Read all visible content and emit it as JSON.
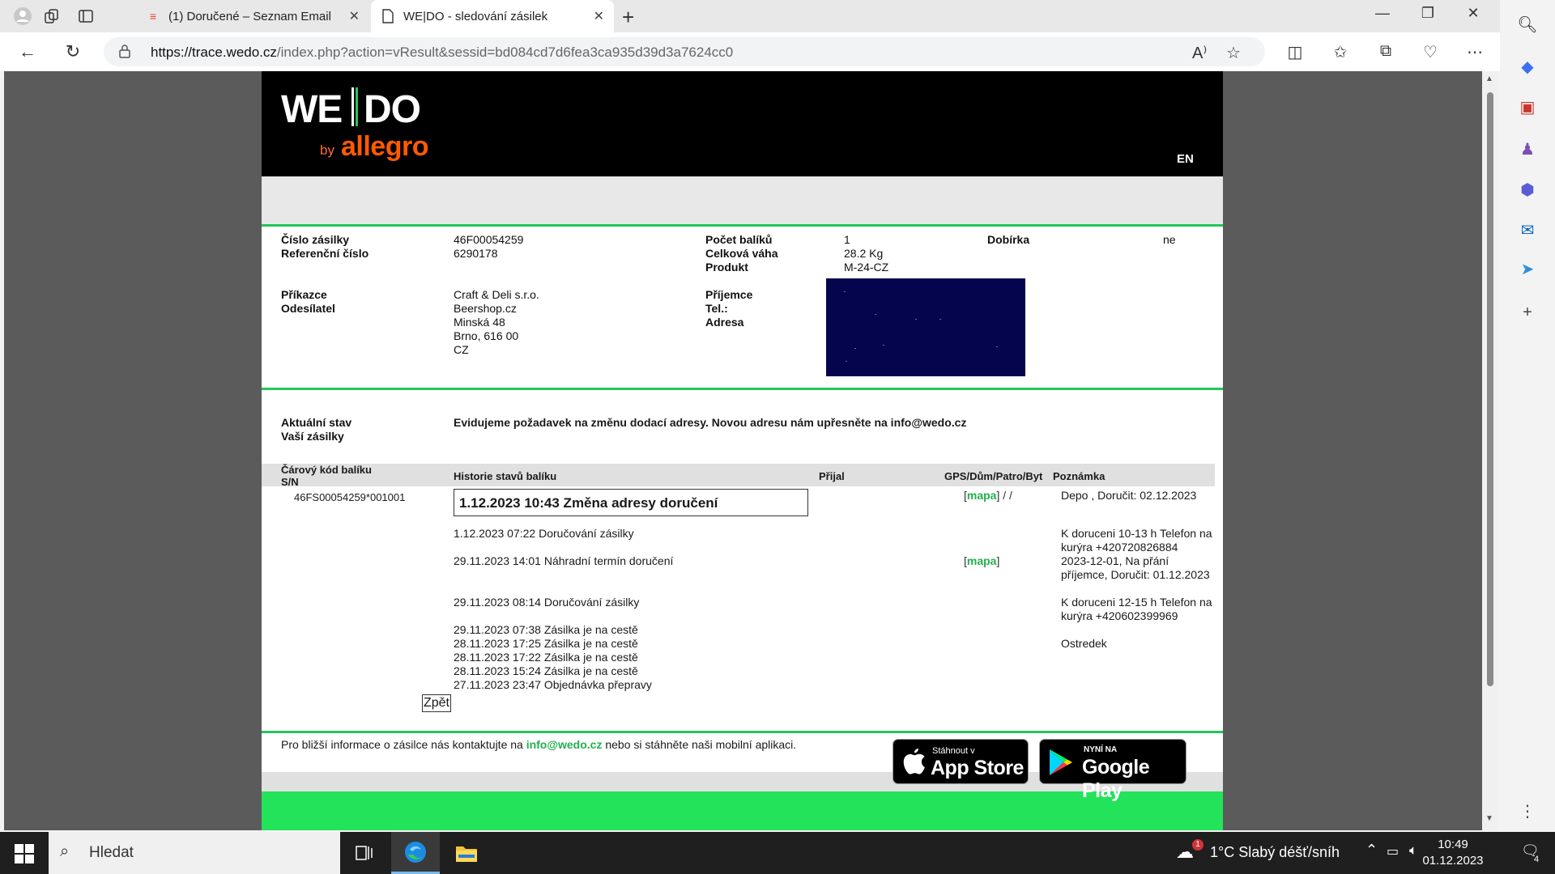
{
  "browser": {
    "tabs": [
      {
        "title": "(1) Doručené – Seznam Email",
        "active": false
      },
      {
        "title": "WE|DO - sledování zásilek",
        "active": true
      }
    ],
    "url_host": "https://trace.wedo.cz",
    "url_path": "/index.php?action=vResult&sessid=bd084cd7d6fea3ca935d39d3a7624cc0"
  },
  "header": {
    "logo_we": "WE",
    "logo_do": "DO",
    "logo_by": "by",
    "logo_allegro": "allegro",
    "lang": "EN"
  },
  "shipment": {
    "cislo_label": "Číslo zásilky",
    "cislo_value": "46F00054259",
    "ref_label": "Referenční číslo",
    "ref_value": "6290178",
    "pocet_label": "Počet balíků",
    "pocet_value": "1",
    "vaha_label": "Celková váha",
    "vaha_value": "28.2 Kg",
    "produkt_label": "Produkt",
    "produkt_value": "M-24-CZ",
    "dobirka_label": "Dobírka",
    "dobirka_value": "ne",
    "prikazce_label": "Příkazce",
    "odesilatel_label": "Odesílatel",
    "sender_lines": [
      "Craft & Deli s.r.o.",
      "Beershop.cz",
      "Minská 48",
      "Brno, 616 00",
      "CZ"
    ],
    "prijemce_label": "Příjemce",
    "tel_label": "Tel.:",
    "adresa_label": "Adresa"
  },
  "status": {
    "label_line1": "Aktuální stav",
    "label_line2": "Vaší zásilky",
    "message": "Evidujeme požadavek na změnu dodací adresy. Novou adresu nám upřesněte na info@wedo.cz"
  },
  "history": {
    "col_barcode_line1": "Čárový kód balíku",
    "col_barcode_line2": "S/N",
    "col_history": "Historie stavů balíku",
    "col_prijal": "Přijal",
    "col_gps": "GPS/Dům/Patro/Byt",
    "col_note": "Poznámka",
    "barcode": "46FS00054259*001001",
    "highlight_event": "1.12.2023 10:43 Změna adresy doručení",
    "events": [
      "1.12.2023 07:22 Doručování zásilky",
      "29.11.2023 14:01 Náhradní termín doručení",
      "29.11.2023 08:14 Doručování zásilky",
      "29.11.2023 07:38 Zásilka je na cestě",
      "28.11.2023 17:25 Zásilka je na cestě",
      "28.11.2023 17:22 Zásilka je na cestě",
      "28.11.2023 15:24 Zásilka je na cestě",
      "27.11.2023 23:47 Objednávka přepravy"
    ],
    "gps_link": "mapa",
    "gps_suffix_1": " / /",
    "notes": [
      "Depo , Doručit: 02.12.2023",
      "K doruceni 10-13 h Telefon na kurýra +420720826884",
      "2023-12-01, Na přání příjemce, Doručit: 01.12.2023",
      "K doruceni 12-15 h Telefon na kurýra +420602399969",
      "Ostredek"
    ],
    "back_button": "Zpět"
  },
  "footer": {
    "text_before": "Pro bližší informace o zásilce nás kontaktujte na ",
    "email": "info@wedo.cz",
    "text_after": " nebo si stáhněte naši mobilní aplikaci.",
    "appstore_small": "Stáhnout v",
    "appstore_big": "App Store",
    "gplay_small": "NYNÍ NA",
    "gplay_big": "Google Play"
  },
  "taskbar": {
    "search_placeholder": "Hledat",
    "weather": "1°C  Slabý déšť/sníh",
    "weather_badge": "1",
    "time": "10:49",
    "date": "01.12.2023",
    "notifications": "4"
  },
  "colors": {
    "brand_green": "#22c65a",
    "allegro_orange": "#ff5a00",
    "redaction": "#05054e"
  }
}
